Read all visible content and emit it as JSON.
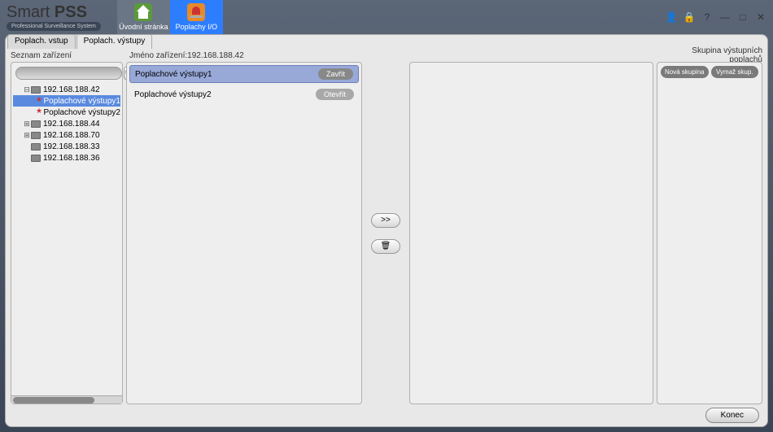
{
  "app": {
    "name_plain": "Smart ",
    "name_bold": "PSS",
    "tagline": "Professional Surveillance System"
  },
  "main_tabs": {
    "home": "Úvodní stránka",
    "alarm": "Poplachy I/O"
  },
  "subtabs": {
    "input": "Poplach. vstup",
    "output": "Poplach. výstupy"
  },
  "labels": {
    "device_list": "Seznam zařízení",
    "device_name_prefix": "Jméno zařízení:",
    "device_name_value": "192.168.188.42",
    "group": "Skupina výstupních poplachů"
  },
  "tree": {
    "root1": "192.168.188.42",
    "root1_child1": "Poplachové výstupy1",
    "root1_child2": "Poplachové výstupy2",
    "root2": "192.168.188.44",
    "root3": "192.168.188.70",
    "root4": "192.168.188.33",
    "root5": "192.168.188.36"
  },
  "list": {
    "row1": {
      "label": "Poplachové výstupy1",
      "action": "Zavřít"
    },
    "row2": {
      "label": "Poplachové výstupy2",
      "action": "Otevřít"
    }
  },
  "group_panel": {
    "new": "Nová skupina",
    "delete": "Vymaž skup."
  },
  "footer": {
    "end": "Konec"
  },
  "icons": {
    "move_right": ">>",
    "trash": "🗑"
  }
}
